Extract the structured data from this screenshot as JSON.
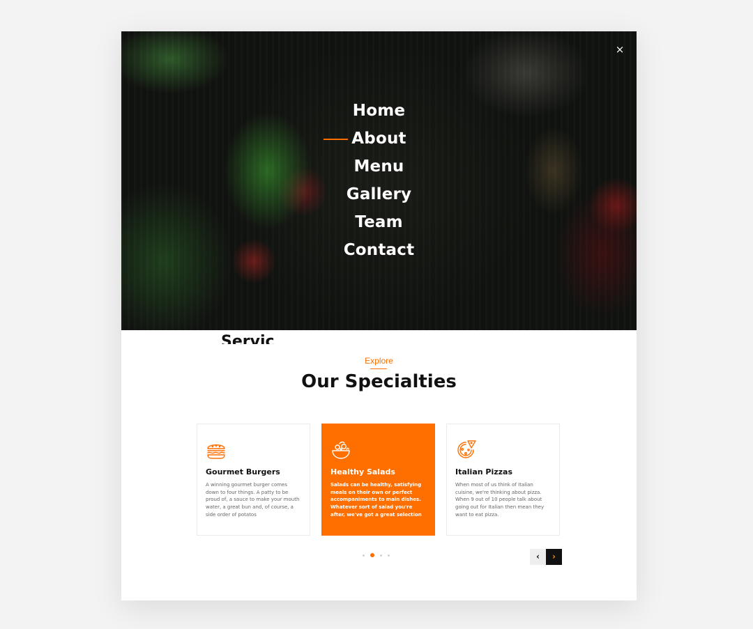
{
  "overlay": {
    "close_icon": "×",
    "nav": [
      {
        "label": "Home",
        "active": false
      },
      {
        "label": "About",
        "active": true
      },
      {
        "label": "Menu",
        "active": false
      },
      {
        "label": "Gallery",
        "active": false
      },
      {
        "label": "Team",
        "active": false
      },
      {
        "label": "Contact",
        "active": false
      }
    ]
  },
  "peek_text": "Servic",
  "section": {
    "eyebrow": "Explore",
    "title": "Our Specialties"
  },
  "cards": [
    {
      "icon": "burger-icon",
      "title": "Gourmet Burgers",
      "description": "A winning gourmet burger comes down to four things. A patty to be proud of, a sauce to make your mouth water, a great bun and, of course, a side order of potatos"
    },
    {
      "icon": "salad-icon",
      "title": "Healthy Salads",
      "description": "Salads can be healthy, satisfying meals on their own or perfect accompaniments to main dishes. Whatever sort of salad you're after, we've got a great selection"
    },
    {
      "icon": "pizza-icon",
      "title": "Italian Pizzas",
      "description": "When most of us think of Italian cuisine, we're thinking about pizza. When 9 out of 10 people talk about going out for Italian then mean they want to eat pizza."
    }
  ],
  "carousel": {
    "pages": 4,
    "active_page": 2,
    "prev_label": "‹",
    "next_label": "›"
  },
  "colors": {
    "accent": "#ff6f00",
    "dark": "#111111",
    "background": "#f3f3f3"
  }
}
